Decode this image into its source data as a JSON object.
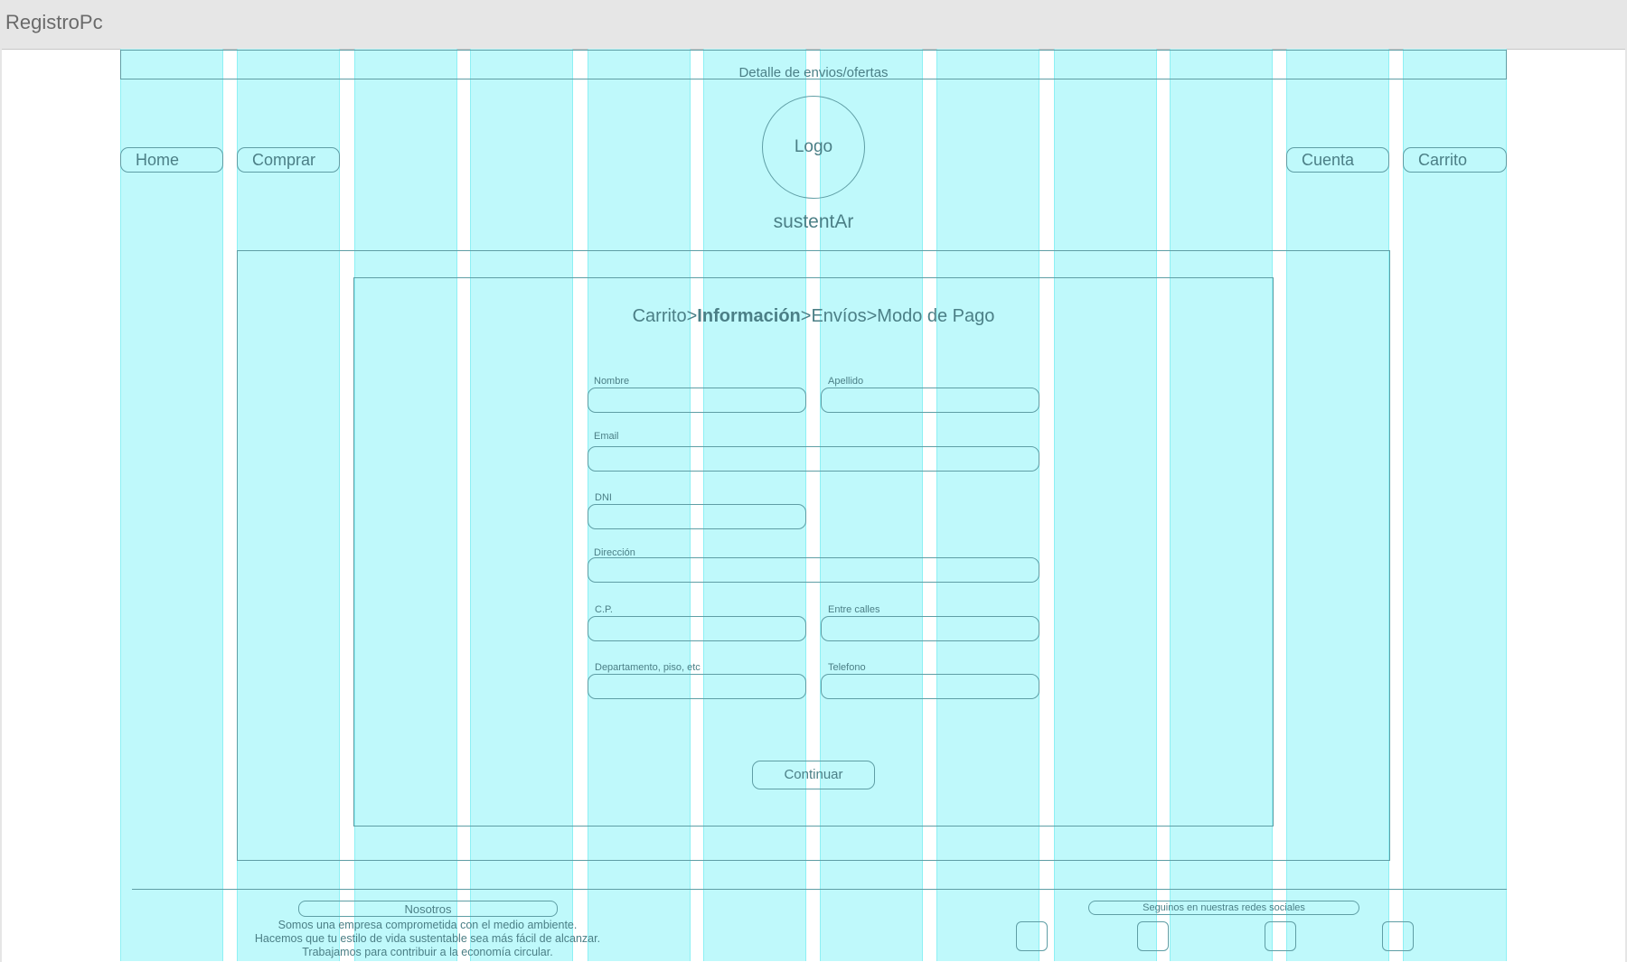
{
  "window": {
    "title": "RegistroPc"
  },
  "header": {
    "banner": "Detalle de envios/ofertas",
    "logo": "Logo",
    "brand": "sustentAr",
    "nav_left": [
      "Home",
      "Comprar"
    ],
    "nav_right": [
      "Cuenta",
      "Carrito"
    ]
  },
  "checkout": {
    "steps": {
      "s1": "Carrito",
      "sep1": ">",
      "s2": "Información",
      "sep2": ">",
      "s3": "Envíos",
      "sep3": ">",
      "s4": "Modo de Pago"
    },
    "fields": {
      "nombre": "Nombre",
      "apellido": "Apellido",
      "email": "Email",
      "dni": "DNI",
      "direccion": "Dirección",
      "cp": "C.P.",
      "entre_calles": "Entre calles",
      "departamento": "Departamento, piso, etc",
      "telefono": "Telefono"
    },
    "continue": "Continuar"
  },
  "footer": {
    "nosotros": "Nosotros",
    "about_lines": [
      "Somos una empresa comprometida con el medio ambiente.",
      "Hacemos que tu estilo de vida sustentable sea más fácil de alcanzar.",
      "Trabajamos para contribuir a la economía circular."
    ],
    "social": "Seguinos en nuestras redes sociales"
  }
}
